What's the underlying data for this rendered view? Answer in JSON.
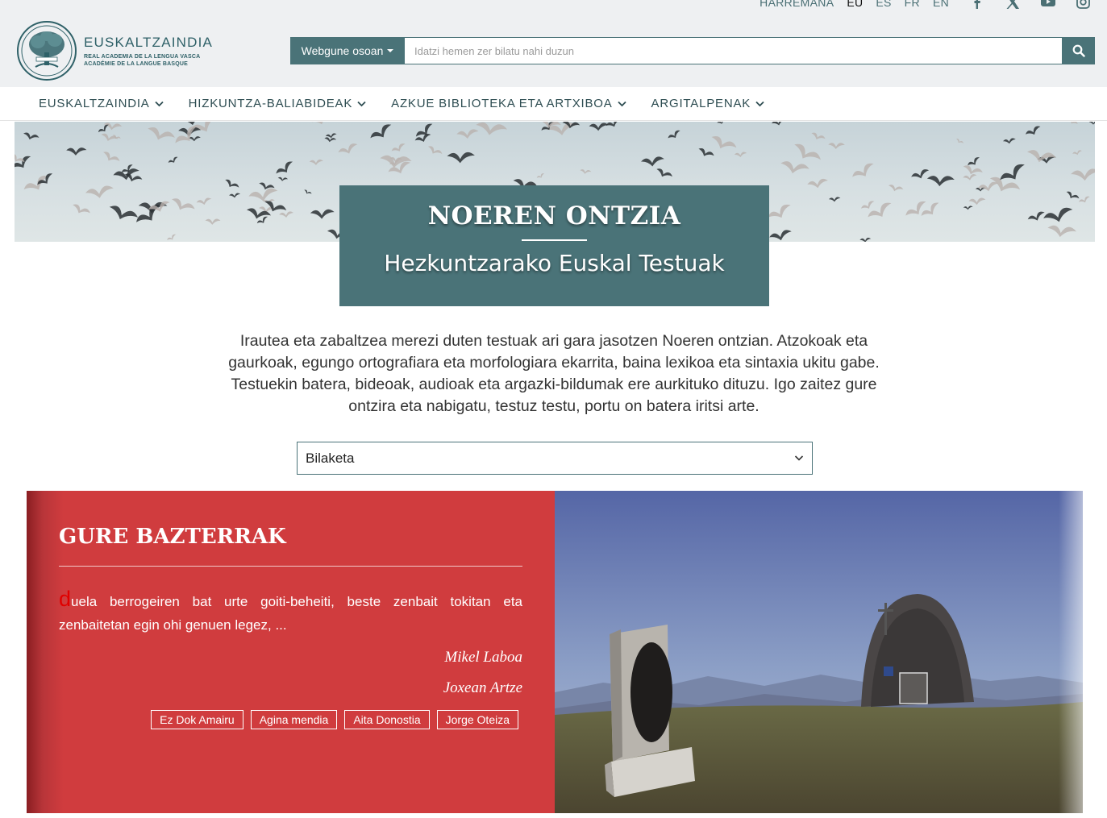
{
  "topbar": {
    "contact_label": "HARREMANA",
    "languages": [
      "EU",
      "ES",
      "FR",
      "EN"
    ],
    "active_language": "EU",
    "social_icons": [
      "facebook-icon",
      "x-icon",
      "youtube-icon",
      "instagram-icon"
    ]
  },
  "logo": {
    "name": "EUSKALTZAINDIA",
    "sub_es": "REAL ACADEMIA DE LA LENGUA VASCA",
    "sub_fr": "ACADÉMIE DE LA LANGUE BASQUE"
  },
  "search": {
    "scope_label": "Webgune osoan",
    "placeholder": "Idatzi hemen zer bilatu nahi duzun",
    "button_icon": "search-icon"
  },
  "nav": {
    "items": [
      {
        "label": "EUSKALTZAINDIA"
      },
      {
        "label": "HIZKUNTZA-BALIABIDEAK"
      },
      {
        "label": "AZKUE BIBLIOTEKA ETA ARTXIBOA"
      },
      {
        "label": "ARGITALPENAK"
      }
    ]
  },
  "hero": {
    "title": "NOEREN ONTZIA",
    "subtitle": "Hezkuntzarako Euskal Testuak"
  },
  "intro": {
    "text": "Irautea eta zabaltzea merezi duten testuak ari gara jasotzen Noeren ontzian. Atzokoak eta gaurkoak, egungo ortografiara eta morfologiara ekarrita, baina lexikoa eta sintaxia ukitu gabe. Testuekin batera, bideoak, audioak eta argazki-bildumak ere aurkituko dituzu. Igo zaitez gure ontzira eta nabigatu, testuz testu, portu on batera iritsi arte."
  },
  "select": {
    "value": "Bilaketa"
  },
  "feature": {
    "title": "GURE BAZTERRAK",
    "dropcap": "d",
    "excerpt": "uela berrogeiren bat urte goiti-beheiti, beste zenbait tokitan eta zenbaitetan egin ohi genuen legez, ...",
    "authors": [
      "Mikel Laboa",
      "Joxean Artze"
    ],
    "tags": [
      "Ez Dok Amairu",
      "Agina mendia",
      "Aita Donostia",
      "Jorge Oteiza"
    ]
  },
  "colors": {
    "teal": "#4a7378",
    "red": "#d03c3e",
    "nav_text": "#2e4d52"
  }
}
